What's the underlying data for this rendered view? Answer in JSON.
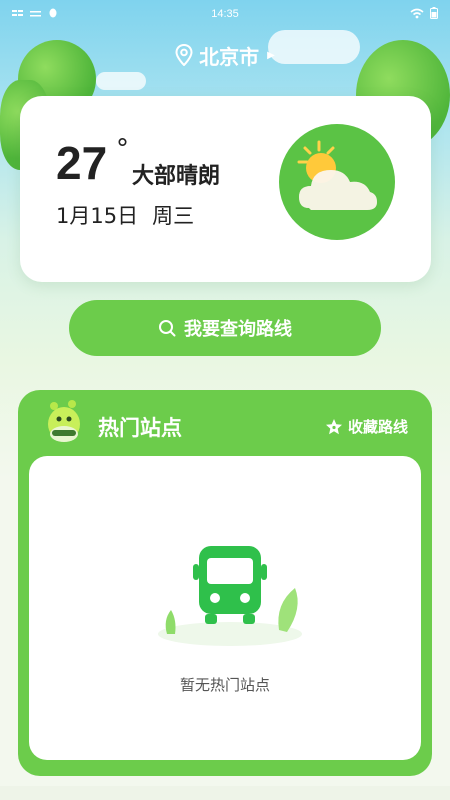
{
  "status_bar": {
    "time": "14:35"
  },
  "header": {
    "city": "北京市"
  },
  "weather": {
    "temperature": "27",
    "degree_symbol": "°",
    "condition": "大部晴朗",
    "date": "1月15日",
    "weekday": "周三",
    "icon": "partly-cloudy-icon"
  },
  "search": {
    "label": "我要查询路线"
  },
  "hot_stations": {
    "title": "热门站点",
    "favorites_label": "收藏路线",
    "empty_text": "暂无热门站点"
  },
  "colors": {
    "primary_green": "#6ccc4b",
    "sky_blue": "#7fd3ee"
  }
}
